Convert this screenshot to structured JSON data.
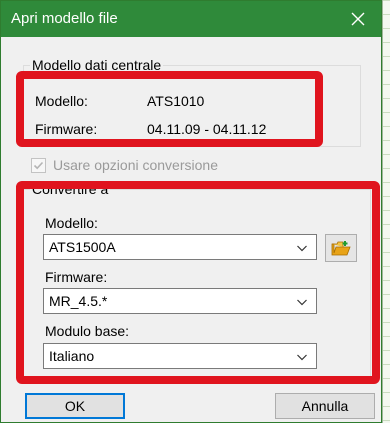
{
  "window": {
    "title": "Apri modello file"
  },
  "control_data": {
    "legend": "Modello dati centrale",
    "model_label": "Modello:",
    "model_value": "ATS1010",
    "firmware_label": "Firmware:",
    "firmware_value": "04.11.09 - 04.11.12"
  },
  "conversion": {
    "checkbox_label": "Usare opzioni conversione",
    "checked": true,
    "enabled": false
  },
  "convert_to": {
    "legend": "Convertire a",
    "model_label": "Modello:",
    "model_value": "ATS1500A",
    "firmware_label": "Firmware:",
    "firmware_value": "MR_4.5.*",
    "base_module_label": "Modulo base:",
    "base_module_value": "Italiano"
  },
  "buttons": {
    "ok": "OK",
    "cancel": "Annulla"
  },
  "icons": {
    "close": "close-icon",
    "open_folder": "open-folder-icon",
    "chevron": "chevron-down-icon"
  },
  "colors": {
    "titlebar": "#2f8a3a",
    "highlight": "#e0141e"
  }
}
